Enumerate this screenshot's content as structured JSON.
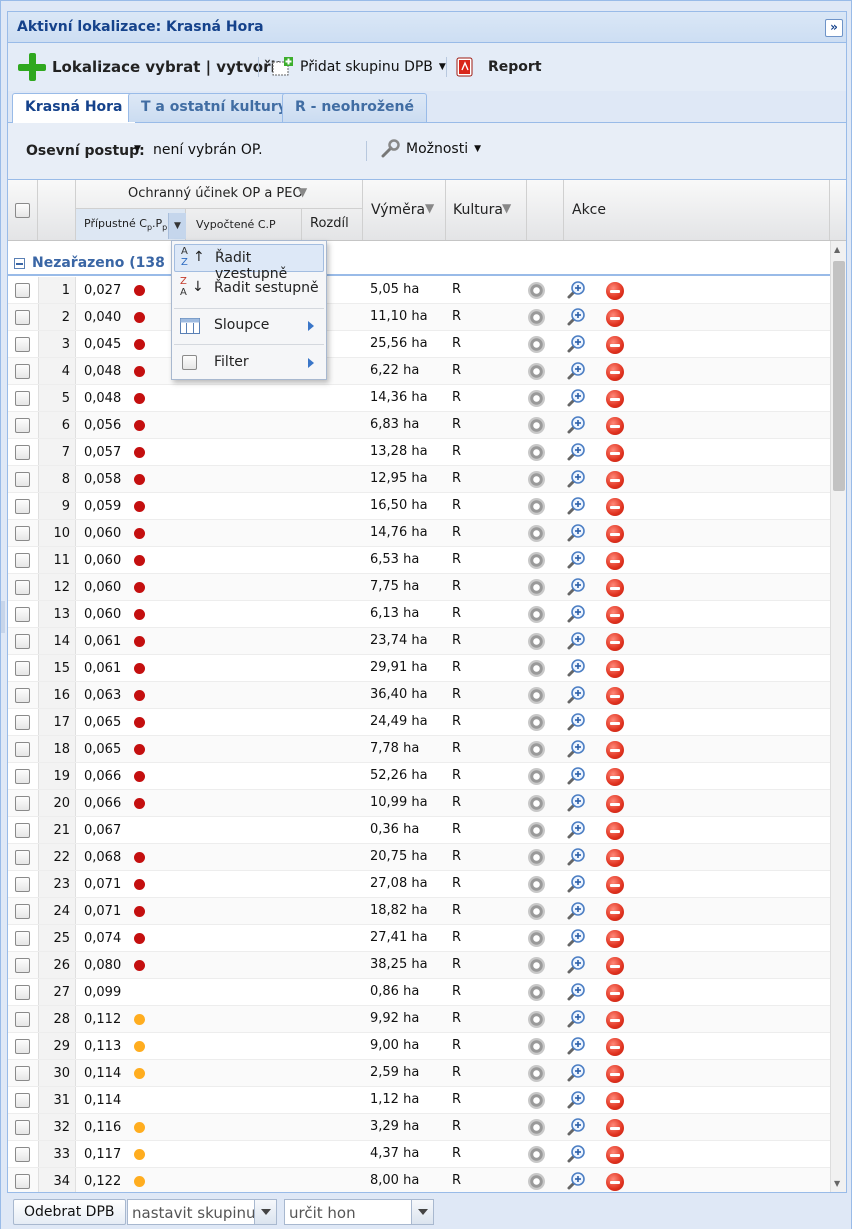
{
  "window": {
    "title": "Aktivní lokalizace: Krasná Hora",
    "collapse_glyph": "»"
  },
  "toolbar": {
    "add_location": "Lokalizace vybrat | vytvořit",
    "add_group": "Přidat skupinu DPB",
    "report": "Report"
  },
  "tabs": [
    "Krasná Hora",
    "T a ostatní kultury",
    "R - neohrožené"
  ],
  "filter": {
    "label": "Osevní postup:",
    "value": "není vybrán OP.",
    "options": "Možnosti"
  },
  "columns": {
    "group_header": "Ochranný účinek OP a PEO",
    "allowed": "Přípustné C",
    "allowed_sub1": "p",
    "allowed_dot": ".P",
    "allowed_sub2": "p",
    "computed": "Vypočtené C.P",
    "difference": "Rozdíl",
    "area": "Výměra",
    "crop": "Kultura",
    "actions": "Akce"
  },
  "group": {
    "label": "Nezařazeno (138 PB"
  },
  "menu": {
    "sort_asc": "Řadit vzestupně",
    "sort_desc": "Řadit sestupně",
    "columns": "Sloupce",
    "filter": "Filter",
    "asc_glyph_top": "A",
    "asc_glyph_bottom": "Z",
    "desc_glyph_top": "Z",
    "desc_glyph_bottom": "A"
  },
  "colors": {
    "red": "#c40f0f",
    "orange": "#ffad1f"
  },
  "rows": [
    {
      "n": "1",
      "v": "0,027",
      "dot": "red",
      "area": "5,05 ha",
      "crop": "R"
    },
    {
      "n": "2",
      "v": "0,040",
      "dot": "red",
      "area": "11,10 ha",
      "crop": "R"
    },
    {
      "n": "3",
      "v": "0,045",
      "dot": "red",
      "area": "25,56 ha",
      "crop": "R"
    },
    {
      "n": "4",
      "v": "0,048",
      "dot": "red",
      "area": "6,22 ha",
      "crop": "R"
    },
    {
      "n": "5",
      "v": "0,048",
      "dot": "red",
      "area": "14,36 ha",
      "crop": "R"
    },
    {
      "n": "6",
      "v": "0,056",
      "dot": "red",
      "area": "6,83 ha",
      "crop": "R"
    },
    {
      "n": "7",
      "v": "0,057",
      "dot": "red",
      "area": "13,28 ha",
      "crop": "R"
    },
    {
      "n": "8",
      "v": "0,058",
      "dot": "red",
      "area": "12,95 ha",
      "crop": "R"
    },
    {
      "n": "9",
      "v": "0,059",
      "dot": "red",
      "area": "16,50 ha",
      "crop": "R"
    },
    {
      "n": "10",
      "v": "0,060",
      "dot": "red",
      "area": "14,76 ha",
      "crop": "R"
    },
    {
      "n": "11",
      "v": "0,060",
      "dot": "red",
      "area": "6,53 ha",
      "crop": "R"
    },
    {
      "n": "12",
      "v": "0,060",
      "dot": "red",
      "area": "7,75 ha",
      "crop": "R"
    },
    {
      "n": "13",
      "v": "0,060",
      "dot": "red",
      "area": "6,13 ha",
      "crop": "R"
    },
    {
      "n": "14",
      "v": "0,061",
      "dot": "red",
      "area": "23,74 ha",
      "crop": "R"
    },
    {
      "n": "15",
      "v": "0,061",
      "dot": "red",
      "area": "29,91 ha",
      "crop": "R"
    },
    {
      "n": "16",
      "v": "0,063",
      "dot": "red",
      "area": "36,40 ha",
      "crop": "R"
    },
    {
      "n": "17",
      "v": "0,065",
      "dot": "red",
      "area": "24,49 ha",
      "crop": "R"
    },
    {
      "n": "18",
      "v": "0,065",
      "dot": "red",
      "area": "7,78 ha",
      "crop": "R"
    },
    {
      "n": "19",
      "v": "0,066",
      "dot": "red",
      "area": "52,26 ha",
      "crop": "R"
    },
    {
      "n": "20",
      "v": "0,066",
      "dot": "red",
      "area": "10,99 ha",
      "crop": "R"
    },
    {
      "n": "21",
      "v": "0,067",
      "dot": "",
      "area": "0,36 ha",
      "crop": "R"
    },
    {
      "n": "22",
      "v": "0,068",
      "dot": "red",
      "area": "20,75 ha",
      "crop": "R"
    },
    {
      "n": "23",
      "v": "0,071",
      "dot": "red",
      "area": "27,08 ha",
      "crop": "R"
    },
    {
      "n": "24",
      "v": "0,071",
      "dot": "red",
      "area": "18,82 ha",
      "crop": "R"
    },
    {
      "n": "25",
      "v": "0,074",
      "dot": "red",
      "area": "27,41 ha",
      "crop": "R"
    },
    {
      "n": "26",
      "v": "0,080",
      "dot": "red",
      "area": "38,25 ha",
      "crop": "R"
    },
    {
      "n": "27",
      "v": "0,099",
      "dot": "",
      "area": "0,86 ha",
      "crop": "R"
    },
    {
      "n": "28",
      "v": "0,112",
      "dot": "orange",
      "area": "9,92 ha",
      "crop": "R"
    },
    {
      "n": "29",
      "v": "0,113",
      "dot": "orange",
      "area": "9,00 ha",
      "crop": "R"
    },
    {
      "n": "30",
      "v": "0,114",
      "dot": "orange",
      "area": "2,59 ha",
      "crop": "R"
    },
    {
      "n": "31",
      "v": "0,114",
      "dot": "",
      "area": "1,12 ha",
      "crop": "R"
    },
    {
      "n": "32",
      "v": "0,116",
      "dot": "orange",
      "area": "3,29 ha",
      "crop": "R"
    },
    {
      "n": "33",
      "v": "0,117",
      "dot": "orange",
      "area": "4,37 ha",
      "crop": "R"
    },
    {
      "n": "34",
      "v": "0,122",
      "dot": "orange",
      "area": "8,00 ha",
      "crop": "R"
    }
  ],
  "footer": {
    "remove": "Odebrat DPB",
    "set_group": "nastavit skupinu",
    "set_field": "určit hon"
  }
}
